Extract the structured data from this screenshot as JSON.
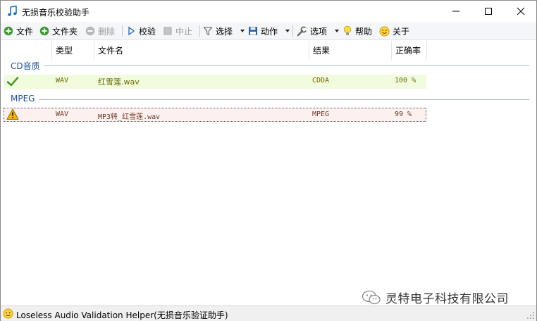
{
  "window": {
    "title": "无损音乐校验助手"
  },
  "toolbar": {
    "file_label": "文件",
    "folder_label": "文件夹",
    "delete_label": "删除",
    "verify_label": "校验",
    "stop_label": "中止",
    "select_label": "选择",
    "action_label": "动作",
    "options_label": "选项",
    "help_label": "帮助",
    "about_label": "关于"
  },
  "columns": {
    "type": "类型",
    "filename": "文件名",
    "result": "结果",
    "accuracy": "正确率"
  },
  "groups": [
    {
      "title": "CD音质",
      "rows": [
        {
          "type": "WAV",
          "filename": "红雪莲.wav",
          "result": "CDDA",
          "accuracy": "100 %",
          "status_icon": "check-icon"
        }
      ]
    },
    {
      "title": "MPEG",
      "rows": [
        {
          "type": "WAV",
          "filename": "MP3转_红雪莲.wav",
          "result": "MPEG",
          "accuracy": "99 %",
          "status_icon": "warning-icon"
        }
      ]
    }
  ],
  "watermark": {
    "text": "灵特电子科技有限公司"
  },
  "statusbar": {
    "text": "Loseless Audio Validation Helper(无损音乐验证助手)"
  },
  "colors": {
    "group_title": "#1e4e9b",
    "selected_row": "#f1fbde",
    "warning_row": "#fdf1ef"
  }
}
